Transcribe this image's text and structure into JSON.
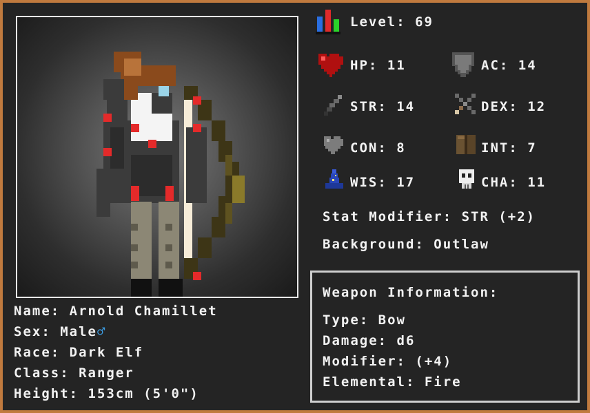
{
  "character": {
    "name_label": "Name: Arnold Chamillet",
    "sex_label": "Sex: Male",
    "sex_symbol": "♂",
    "race_label": "Race: Dark Elf",
    "class_label": "Class: Ranger",
    "height_label": "Height: 153cm (5'0\")"
  },
  "stats": {
    "level": "Level: 69",
    "hp": "HP: 11",
    "ac": "AC: 14",
    "str": "STR: 14",
    "dex": "DEX: 12",
    "con": "CON: 8",
    "int": "INT: 7",
    "wis": "WIS: 17",
    "cha": "CHA: 11",
    "stat_modifier": "Stat Modifier: STR (+2)",
    "background": "Background: Outlaw"
  },
  "weapon": {
    "title": "Weapon Information:",
    "type": "Type: Bow",
    "damage": "Damage: d6",
    "modifier": "Modifier: (+4)",
    "elemental": "Elemental: Fire"
  },
  "icons": {
    "level": "level-bars-icon",
    "hp": "heart-icon",
    "ac": "shield-icon",
    "str": "sword-icon",
    "dex": "crossed-daggers-icon",
    "con": "gray-heart-icon",
    "int": "book-icon",
    "wis": "wizard-hat-icon",
    "cha": "skull-icon"
  },
  "colors": {
    "frame": "#c07a3e",
    "background": "#242424",
    "text": "#f2f2f2",
    "male_symbol": "#3da0e8"
  }
}
